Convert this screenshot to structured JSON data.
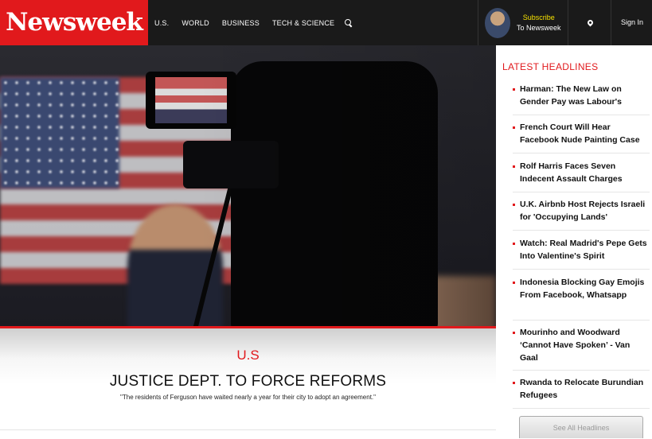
{
  "brand": {
    "logo_text": "Newsweek",
    "accent": "#e1191c"
  },
  "nav": {
    "items": [
      "U.S.",
      "WORLD",
      "BUSINESS",
      "TECH & SCIENCE"
    ],
    "search_icon": "search-icon"
  },
  "subscribe": {
    "line1": "Subscribe",
    "line2": "To Newsweek"
  },
  "location_icon": "location-pin-icon",
  "signin": "Sign In",
  "hero": {
    "section": "U.S",
    "headline": "JUSTICE DEPT. TO FORCE REFORMS",
    "dek": "\"The residents of Ferguson have waited nearly a year for their city to adopt an agreement.\""
  },
  "sidebar": {
    "title": "LATEST HEADLINES",
    "headlines": [
      "Harman: The New Law on Gender Pay was Labour's",
      "French Court Will Hear Facebook Nude Painting Case",
      "Rolf Harris Faces Seven Indecent Assault Charges",
      "U.K. Airbnb Host Rejects Israeli for 'Occupying Lands'",
      "Watch: Real Madrid's Pepe Gets Into Valentine's Spirit",
      "Indonesia Blocking Gay Emojis From Facebook, Whatsapp",
      "Mourinho and Woodward ‘Cannot Have Spoken’ - Van Gaal",
      "Rwanda to Relocate Burundian Refugees"
    ],
    "see_all": "See All Headlines"
  }
}
